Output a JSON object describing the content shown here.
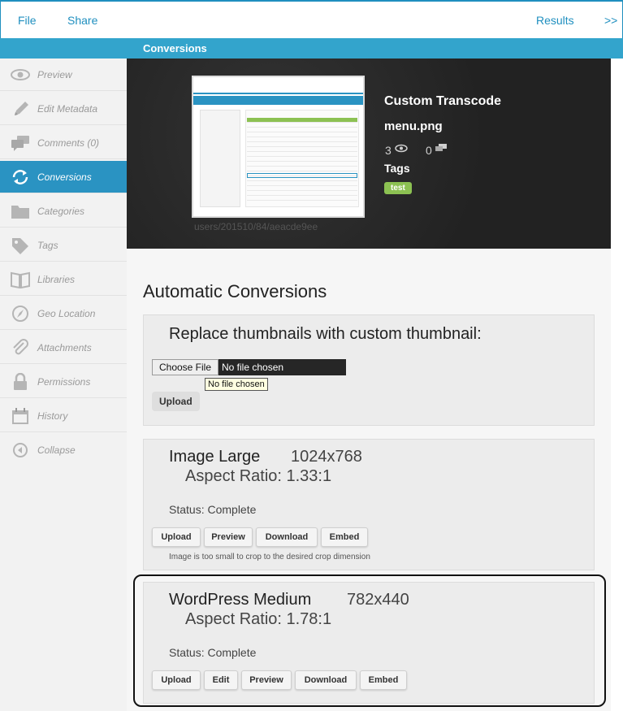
{
  "topnav": {
    "file": "File",
    "share": "Share",
    "results": "Results",
    "more": ">>"
  },
  "subbar": {
    "title": "Conversions"
  },
  "sidebar": {
    "items": [
      {
        "label": "Preview",
        "icon": "eye-icon"
      },
      {
        "label": "Edit Metadata",
        "icon": "pencil-icon"
      },
      {
        "label": "Comments (0)",
        "icon": "comments-icon"
      },
      {
        "label": "Conversions",
        "icon": "refresh-icon",
        "active": true
      },
      {
        "label": "Categories",
        "icon": "folder-icon"
      },
      {
        "label": "Tags",
        "icon": "tag-icon"
      },
      {
        "label": "Libraries",
        "icon": "book-icon"
      },
      {
        "label": "Geo Location",
        "icon": "compass-icon"
      },
      {
        "label": "Attachments",
        "icon": "paperclip-icon"
      },
      {
        "label": "Permissions",
        "icon": "lock-icon"
      },
      {
        "label": "History",
        "icon": "calendar-icon"
      },
      {
        "label": "Collapse",
        "icon": "collapse-icon"
      }
    ]
  },
  "hero": {
    "title": "Custom Transcode",
    "filename": "menu.png",
    "views": "3",
    "comments": "0",
    "tags_label": "Tags",
    "tag": "test",
    "path": "users/201510/84/aeacde9ee"
  },
  "main": {
    "heading": "Automatic Conversions",
    "custom_thumb": {
      "title": "Replace thumbnails with custom thumbnail:",
      "choose_file": "Choose File",
      "no_file": "No file chosen",
      "tooltip": "No file chosen",
      "upload": "Upload"
    },
    "conversions": [
      {
        "name": "Image Large",
        "dimensions": "1024x768",
        "aspect": "Aspect Ratio: 1.33:1",
        "status": "Status: Complete",
        "buttons": [
          "Upload",
          "Preview",
          "Download",
          "Embed"
        ],
        "note": "Image is too small to crop to the desired crop dimension"
      },
      {
        "name": "WordPress Medium",
        "dimensions": "782x440",
        "aspect": "Aspect Ratio: 1.78:1",
        "status": "Status: Complete",
        "buttons": [
          "Upload",
          "Edit",
          "Preview",
          "Download",
          "Embed"
        ]
      }
    ]
  },
  "colors": {
    "accent": "#2a93c2",
    "tag": "#8cc152",
    "hero_bg": "#262626"
  }
}
